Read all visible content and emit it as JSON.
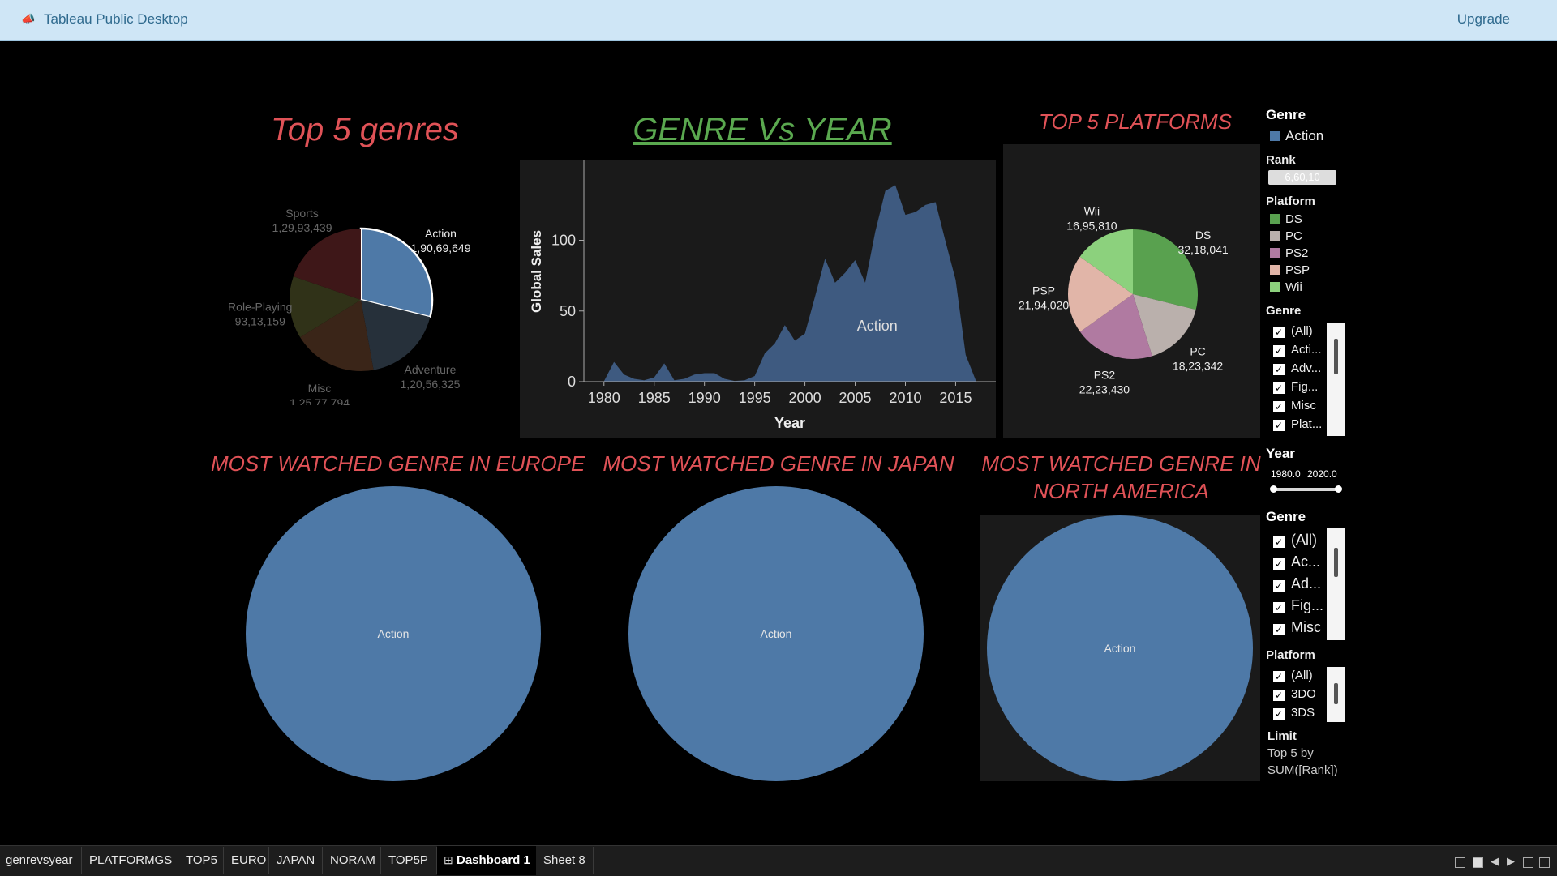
{
  "app": {
    "title": "Tableau Public Desktop",
    "upgrade": "Upgrade"
  },
  "titles": {
    "top5": "Top 5 genres",
    "genre_vs_year": "GENRE Vs YEAR",
    "top5_platforms": "TOP 5 PLATFORMS",
    "europe": "MOST WATCHED GENRE IN EUROPE",
    "japan": "MOST WATCHED GENRE IN JAPAN",
    "na_line1": "MOST WATCHED GENRE IN",
    "na_line2": "NORTH AMERICA"
  },
  "colors": {
    "title_red": "#e05257",
    "title_green": "#5aa84f",
    "action_blue": "#4e79a7"
  },
  "chart_data": [
    {
      "type": "pie",
      "id": "top5_genres",
      "slices": [
        {
          "label": "Action",
          "value_label": "1,90,69,649",
          "value": 19069649,
          "color": "#4e79a7",
          "highlighted": true
        },
        {
          "label": "Adventure",
          "value_label": "1,20,56,325",
          "value": 12056325,
          "color": "#26303a"
        },
        {
          "label": "Misc",
          "value_label": "1,25,77,794",
          "value": 12577794,
          "color": "#3a2518"
        },
        {
          "label": "Role-Playing",
          "value_label": "93,13,159",
          "value": 9313159,
          "color": "#303218"
        },
        {
          "label": "Sports",
          "value_label": "1,29,93,439",
          "value": 12993439,
          "color": "#3e1718"
        }
      ]
    },
    {
      "type": "area",
      "id": "genre_vs_year",
      "series": [
        {
          "name": "Action",
          "x": [
            1980,
            1981,
            1982,
            1983,
            1984,
            1985,
            1986,
            1987,
            1988,
            1989,
            1990,
            1991,
            1992,
            1993,
            1994,
            1995,
            1996,
            1997,
            1998,
            1999,
            2000,
            2001,
            2002,
            2003,
            2004,
            2005,
            2006,
            2007,
            2008,
            2009,
            2010,
            2011,
            2012,
            2013,
            2014,
            2015,
            2016,
            2017
          ],
          "y": [
            0.3,
            14,
            5,
            2,
            1,
            3,
            13,
            1,
            2,
            5,
            6,
            6,
            2,
            0.5,
            1,
            4,
            20,
            27,
            40,
            29,
            34,
            60,
            87,
            70,
            77,
            86,
            70,
            106,
            135,
            139,
            118,
            120,
            125,
            127,
            99,
            72,
            19,
            1
          ]
        }
      ],
      "xlabel": "Year",
      "ylabel": "Global Sales",
      "xticks": [
        1980,
        1985,
        1990,
        1995,
        2000,
        2005,
        2010,
        2015
      ],
      "yticks": [
        0,
        50,
        100
      ],
      "xlim": [
        1978,
        2019
      ],
      "ylim": [
        0,
        145
      ],
      "mark_label": "Action"
    },
    {
      "type": "pie",
      "id": "top5_platforms",
      "slices": [
        {
          "label": "DS",
          "value_label": "32,18,041",
          "value": 3218041,
          "color": "#59a14f"
        },
        {
          "label": "PC",
          "value_label": "18,23,342",
          "value": 1823342,
          "color": "#bab0ac"
        },
        {
          "label": "PS2",
          "value_label": "22,23,430",
          "value": 2223430,
          "color": "#b07aa1"
        },
        {
          "label": "PSP",
          "value_label": "21,94,020",
          "value": 2194020,
          "color": "#e1b5a8"
        },
        {
          "label": "Wii",
          "value_label": "16,95,810",
          "value": 1695810,
          "color": "#8cd17d"
        }
      ]
    },
    {
      "type": "pie",
      "id": "europe",
      "slices": [
        {
          "label": "Action",
          "value": 1,
          "color": "#4e79a7"
        }
      ]
    },
    {
      "type": "pie",
      "id": "japan",
      "slices": [
        {
          "label": "Action",
          "value": 1,
          "color": "#4e79a7"
        }
      ]
    },
    {
      "type": "pie",
      "id": "north_america",
      "slices": [
        {
          "label": "Action",
          "value": 1,
          "color": "#4e79a7"
        }
      ]
    }
  ],
  "sidebar": {
    "genre_legend": {
      "title": "Genre",
      "item": "Action"
    },
    "rank": {
      "title": "Rank",
      "value": "6,60,10"
    },
    "platform_legend": {
      "title": "Platform",
      "items": [
        "DS",
        "PC",
        "PS2",
        "PSP",
        "Wii"
      ]
    },
    "genre_filter1": {
      "title": "Genre",
      "items": [
        "(All)",
        "Acti...",
        "Adv...",
        "Fig...",
        "Misc",
        "Plat..."
      ]
    },
    "year": {
      "title": "Year",
      "min": "1980.0",
      "max": "2020.0"
    },
    "genre_filter2": {
      "title": "Genre",
      "items": [
        "(All)",
        "Ac...",
        "Ad...",
        "Fig...",
        "Misc"
      ]
    },
    "platform_filter": {
      "title": "Platform",
      "items": [
        "(All)",
        "3DO",
        "3DS"
      ]
    },
    "limit": {
      "title": "Limit",
      "line1": "Top 5 by",
      "line2": "SUM([Rank])"
    }
  },
  "tabs": [
    "genrevsyear",
    "PLATFORMGS",
    "TOP5",
    "EURO",
    "JAPAN",
    "NORAM",
    "TOP5P",
    "Dashboard 1",
    "Sheet 8"
  ],
  "active_tab": "Dashboard 1"
}
